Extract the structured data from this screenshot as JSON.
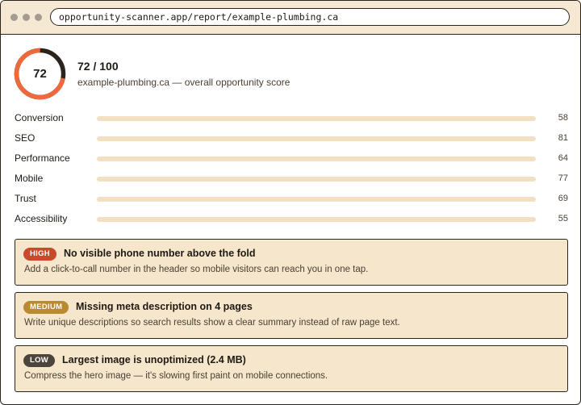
{
  "browser": {
    "url": "opportunity-scanner.app/report/example-plumbing.ca"
  },
  "score": {
    "value": "72",
    "fraction": 0.72,
    "headline": "72 / 100",
    "subtitle": "example-plumbing.ca — overall opportunity score",
    "ring_color": "#ee6a3c",
    "ring_track_color": "#2b241c"
  },
  "metrics": [
    {
      "label": "Conversion",
      "value": "58",
      "fraction": 0.58
    },
    {
      "label": "SEO",
      "value": "81",
      "fraction": 0.81
    },
    {
      "label": "Performance",
      "value": "64",
      "fraction": 0.64
    },
    {
      "label": "Mobile",
      "value": "77",
      "fraction": 0.77
    },
    {
      "label": "Trust",
      "value": "69",
      "fraction": 0.69
    },
    {
      "label": "Accessibility",
      "value": "55",
      "fraction": 0.55
    }
  ],
  "issues": [
    {
      "severity": "HIGH",
      "severity_color": "#c94a2b",
      "title": "No visible phone number above the fold",
      "description": "Add a click-to-call number in the header so mobile visitors can reach you in one tap."
    },
    {
      "severity": "MEDIUM",
      "severity_color": "#b98a32",
      "title": "Missing meta description on 4 pages",
      "description": "Write unique descriptions so search results show a clear summary instead of raw page text."
    },
    {
      "severity": "LOW",
      "severity_color": "#4d453c",
      "title": "Largest image is unoptimized (2.4 MB)",
      "description": "Compress the hero image — it's slowing first paint on mobile connections."
    }
  ]
}
